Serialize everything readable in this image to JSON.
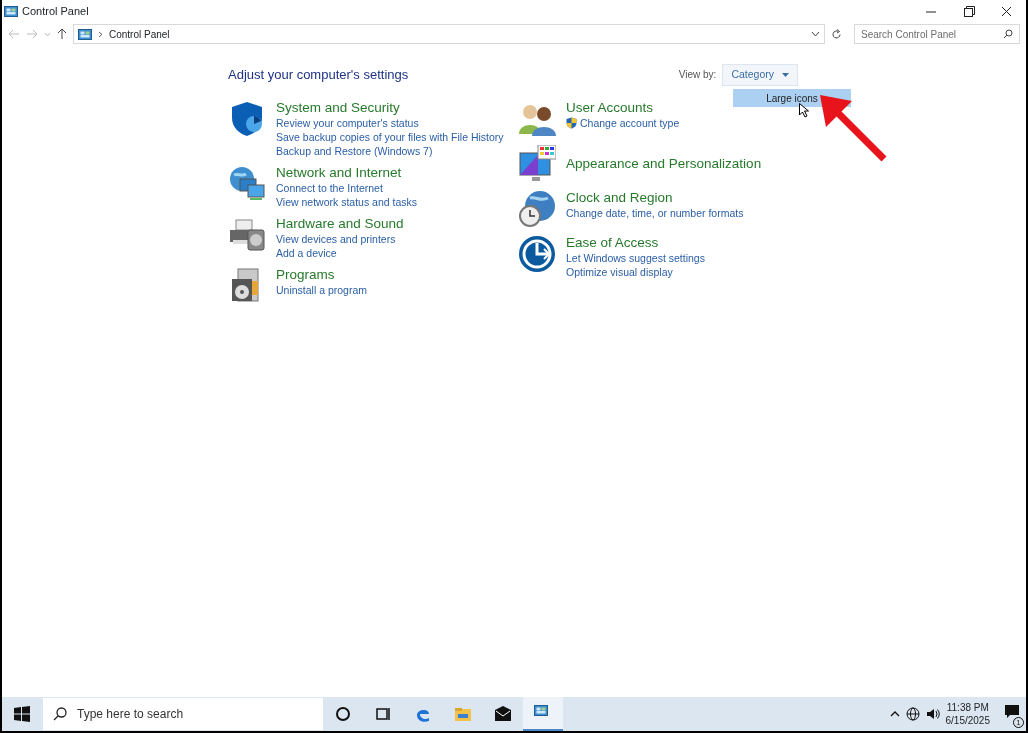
{
  "window": {
    "title": "Control Panel"
  },
  "address_bar": {
    "path": "Control Panel"
  },
  "search": {
    "placeholder": "Search Control Panel"
  },
  "heading": "Adjust your computer's settings",
  "view_by": {
    "label": "View by:",
    "value": "Category"
  },
  "view_menu": [
    {
      "label": "Large icons",
      "selected": true
    }
  ],
  "columns": [
    {
      "categories": [
        {
          "title": "System and Security",
          "links": [
            {
              "label": "Review your computer's status",
              "elevated": false
            },
            {
              "label": "Save backup copies of your files with File History",
              "elevated": false
            },
            {
              "label": "Backup and Restore (Windows 7)",
              "elevated": false
            }
          ]
        },
        {
          "title": "Network and Internet",
          "links": [
            {
              "label": "Connect to the Internet",
              "elevated": false
            },
            {
              "label": "View network status and tasks",
              "elevated": false
            }
          ]
        },
        {
          "title": "Hardware and Sound",
          "links": [
            {
              "label": "View devices and printers",
              "elevated": false
            },
            {
              "label": "Add a device",
              "elevated": false
            }
          ]
        },
        {
          "title": "Programs",
          "links": [
            {
              "label": "Uninstall a program",
              "elevated": false
            }
          ]
        }
      ]
    },
    {
      "categories": [
        {
          "title": "User Accounts",
          "links": [
            {
              "label": "Change account type",
              "elevated": true
            }
          ]
        },
        {
          "title": "Appearance and Personalization"
        },
        {
          "title": "Clock and Region",
          "links": [
            {
              "label": "Change date, time, or number formats",
              "elevated": false
            }
          ]
        },
        {
          "title": "Ease of Access",
          "links": [
            {
              "label": "Let Windows suggest settings",
              "elevated": false
            },
            {
              "label": "Optimize visual display",
              "elevated": false
            }
          ]
        }
      ]
    }
  ],
  "taskbar": {
    "search_placeholder": "Type here to search",
    "apps": [
      {
        "selected": false
      },
      {
        "selected": false
      },
      {
        "selected": false
      },
      {
        "selected": false
      },
      {
        "selected": false
      },
      {
        "selected": true
      }
    ],
    "time": "11:38 PM",
    "date": "6/15/2025",
    "notifications": "1"
  }
}
